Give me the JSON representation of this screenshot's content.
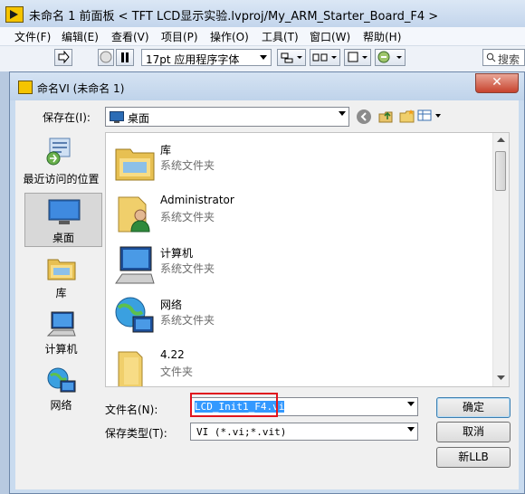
{
  "main_window": {
    "title": "未命名 1 前面板 < TFT LCD显示实验.lvproj/My_ARM_Starter_Board_F4 >",
    "menu": [
      "文件(F)",
      "编辑(E)",
      "查看(V)",
      "项目(P)",
      "操作(O)",
      "工具(T)",
      "窗口(W)",
      "帮助(H)"
    ],
    "font_selector": "17pt 应用程序字体",
    "search_placeholder": "搜索"
  },
  "dialog": {
    "title": "命名VI (未命名 1)",
    "close_symbol": "✕",
    "save_in_label": "保存在(I):",
    "save_in_value": "桌面",
    "places": [
      {
        "label": "最近访问的位置",
        "icon": "recent-places-icon"
      },
      {
        "label": "桌面",
        "icon": "desktop-icon",
        "selected": true
      },
      {
        "label": "库",
        "icon": "libraries-icon"
      },
      {
        "label": "计算机",
        "icon": "computer-icon"
      },
      {
        "label": "网络",
        "icon": "network-icon"
      }
    ],
    "files": [
      {
        "name": "库",
        "type": "系统文件夹",
        "icon": "libraries-folder-icon"
      },
      {
        "name": "Administrator",
        "type": "系统文件夹",
        "icon": "user-folder-icon"
      },
      {
        "name": "计算机",
        "type": "系统文件夹",
        "icon": "computer-icon"
      },
      {
        "name": "网络",
        "type": "系统文件夹",
        "icon": "network-icon"
      },
      {
        "name": "4.22",
        "type": "文件夹",
        "icon": "folder-icon"
      }
    ],
    "filename_label": "文件名(N):",
    "filename_value": "LCD_Init1_F4.vi",
    "filetype_label": "保存类型(T):",
    "filetype_value": "VI (*.vi;*.vit)",
    "ok_button": "确定",
    "cancel_button": "取消",
    "new_llb_button": "新LLB"
  },
  "colors": {
    "selection": "#3399ff",
    "highlight_box": "#e0141e",
    "titlebar": "#c9dbef"
  }
}
